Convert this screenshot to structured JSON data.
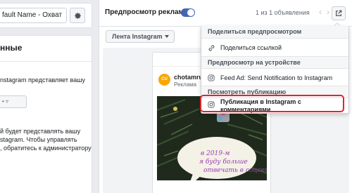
{
  "left_panel": {
    "name_field_value": "fault Name - Охват",
    "section_title": "нные",
    "text_lines_1": [
      "nstagram представляет вашу"
    ],
    "dropdown_stub": "•  ▿",
    "text_lines_2": [
      "й будет представлять вашу",
      "stagram. Чтобы управлять",
      ", обратитесь к администратору"
    ]
  },
  "header": {
    "preview_label": "Предпросмотр рекламы",
    "ad_count": "1 из 1 объявления",
    "prev_arrow": "‹",
    "next_arrow": "›"
  },
  "feed_dropdown": {
    "label": "Лента Instagram"
  },
  "post": {
    "account_name": "chotamru",
    "sponsored_label": "Реклама",
    "avatar_text": "CU"
  },
  "menu": {
    "section_share": "Поделиться предпросмотром",
    "share_link": "Поделиться ссылкой",
    "section_device": "Предпросмотр на устройстве",
    "feed_ad_notification": "Feed Ad: Send Notification to Instagram",
    "section_view_post": "Посмотреть публикацию",
    "instagram_post_with_comments": "Публикация в Instagram с комментариями"
  },
  "colors": {
    "accent": "#4267b2",
    "highlight_outline": "#e0252f"
  }
}
